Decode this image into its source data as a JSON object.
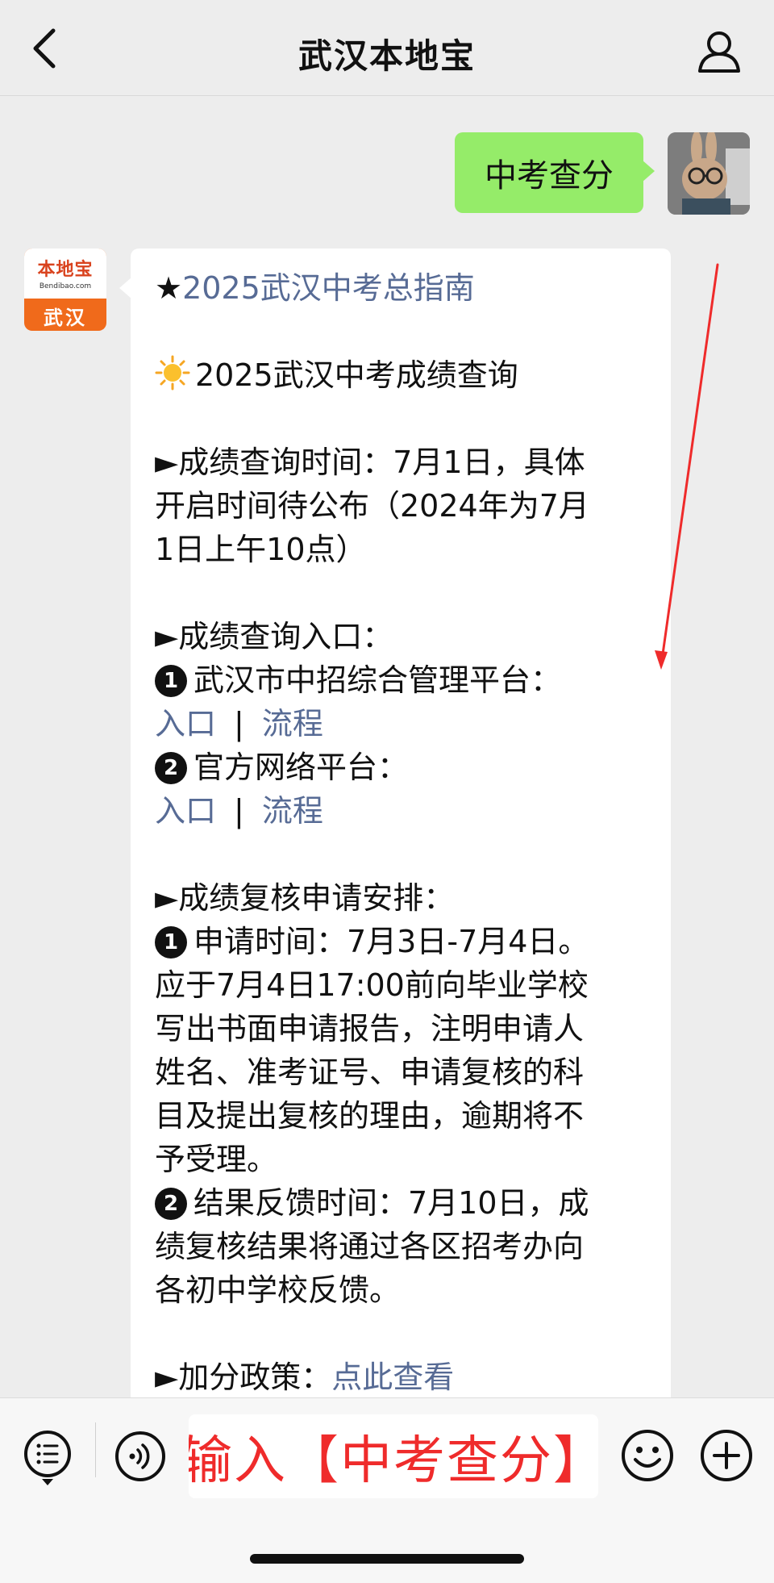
{
  "header": {
    "title": "武汉本地宝",
    "back_icon": "chevron-left-icon",
    "profile_icon": "person-icon"
  },
  "chat": {
    "sent_message": "中考查分",
    "account_avatar": {
      "brand": "本地宝",
      "domain": "Bendibao.com",
      "city": "武汉"
    },
    "received": {
      "guide_star": "★",
      "guide_link": "2025武汉中考总指南",
      "section_title": "2025武汉中考成绩查询",
      "time_heading_lines": [
        "►成绩查询时间：7月1日，具体",
        "开启时间待公布（2024年为7月",
        "1日上午10点）"
      ],
      "entry_heading": "►成绩查询入口：",
      "platform1": "武汉市中招综合管理平台：",
      "platform1_entry": "入口",
      "platform1_process": "流程",
      "platform2": "官方网络平台：",
      "platform2_entry": "入口",
      "platform2_process": "流程",
      "separator": "|",
      "review_heading": "►成绩复核申请安排：",
      "review_lines": [
        "申请时间：7月3日-7月4日。",
        "应于7月4日17:00前向毕业学校",
        "写出书面申请报告，注明申请人",
        "姓名、准考证号、申请复核的科",
        "目及提出复核的理由，逾期将不",
        "予受理。"
      ],
      "feedback_lines": [
        "结果反馈时间：7月10日，成",
        "绩复核结果将通过各区招考办向",
        "各初中学校反馈。"
      ],
      "bonus_label": "►加分政策：",
      "bonus_link": "点此查看",
      "num1": "1",
      "num2": "2"
    }
  },
  "input_bar": {
    "text": "输入【中考查分】",
    "menu_icon": "menu-list-icon",
    "voice_icon": "voice-icon",
    "emoji_icon": "emoji-icon",
    "plus_icon": "plus-icon"
  },
  "colors": {
    "link": "#576b95",
    "sent_bubble": "#95ec69",
    "annotation_red": "#ef2b2b"
  }
}
